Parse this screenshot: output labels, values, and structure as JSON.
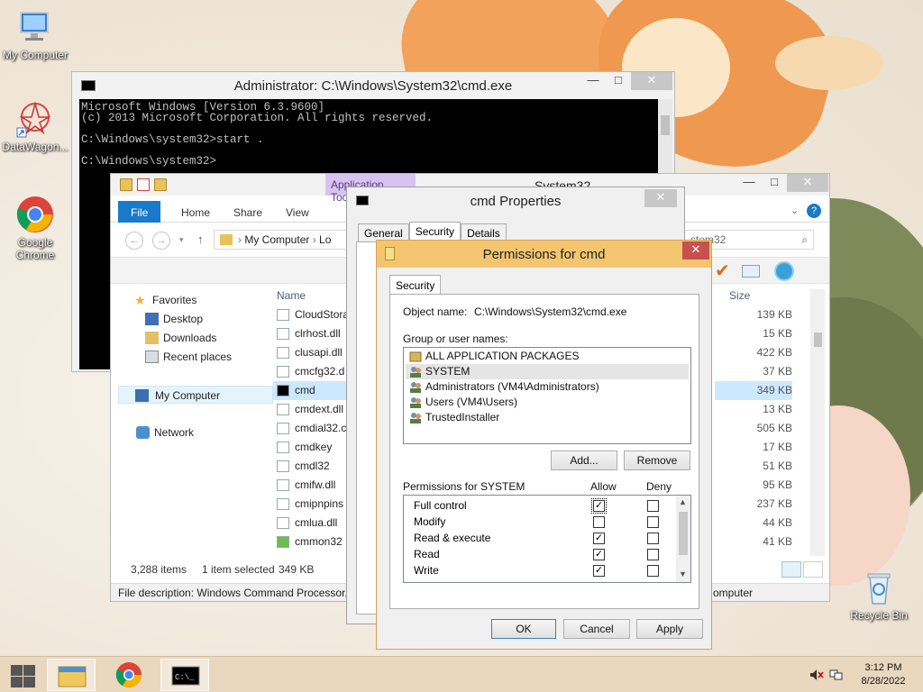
{
  "desktop": {
    "icons": [
      {
        "label": "My Computer",
        "icon": "computer-icon"
      },
      {
        "label": "DataWagon...",
        "icon": "datawagon-icon"
      },
      {
        "label": "Google Chrome",
        "icon": "chrome-icon"
      },
      {
        "label": "Recycle Bin",
        "icon": "recycle-bin-icon"
      }
    ]
  },
  "cmd": {
    "title": "Administrator: C:\\Windows\\System32\\cmd.exe",
    "lines": [
      "Microsoft Windows [Version 6.3.9600]",
      "(c) 2013 Microsoft Corporation. All rights reserved.",
      "",
      "C:\\Windows\\system32>start .",
      "",
      "C:\\Windows\\system32>"
    ],
    "controls": {
      "minimize": "—",
      "maximize": "□",
      "close": "✕"
    }
  },
  "explorer": {
    "context_tab": "Application Tools",
    "title": "System32",
    "ribbon_tabs": [
      "File",
      "Home",
      "Share",
      "View"
    ],
    "address": {
      "root": "My Computer",
      "next": "Lo"
    },
    "search_placeholder": "stem32",
    "nav": {
      "favorites": "Favorites",
      "desktop": "Desktop",
      "downloads": "Downloads",
      "recent": "Recent places",
      "my_computer": "My Computer",
      "network": "Network"
    },
    "columns": {
      "name": "Name",
      "size": "Size"
    },
    "files": [
      {
        "name": "CloudStora",
        "size": "139 KB"
      },
      {
        "name": "clrhost.dll",
        "size": "15 KB"
      },
      {
        "name": "clusapi.dll",
        "size": "422 KB"
      },
      {
        "name": "cmcfg32.d",
        "size": "37 KB"
      },
      {
        "name": "cmd",
        "size": "349 KB"
      },
      {
        "name": "cmdext.dll",
        "size": "13 KB"
      },
      {
        "name": "cmdial32.c",
        "size": "505 KB"
      },
      {
        "name": "cmdkey",
        "size": "17 KB"
      },
      {
        "name": "cmdl32",
        "size": "51 KB"
      },
      {
        "name": "cmifw.dll",
        "size": "95 KB"
      },
      {
        "name": "cmipnpins",
        "size": "237 KB"
      },
      {
        "name": "cmlua.dll",
        "size": "44 KB"
      },
      {
        "name": "cmmon32",
        "size": "41 KB"
      }
    ],
    "status": {
      "items": "3,288 items",
      "selected": "1 item selected",
      "size": "349 KB"
    },
    "description": "File description: Windows Command Processor,",
    "description_tail": "omputer",
    "controls": {
      "minimize": "—",
      "maximize": "□",
      "close": "✕"
    }
  },
  "props": {
    "title": "cmd Properties",
    "tabs": [
      "General",
      "Security",
      "Details"
    ],
    "active_tab": "Security",
    "close": "✕"
  },
  "perm": {
    "title": "Permissions for cmd",
    "tab": "Security",
    "object_label": "Object name:",
    "object_value": "C:\\Windows\\System32\\cmd.exe",
    "group_label": "Group or user names:",
    "groups": [
      {
        "name": "ALL APPLICATION PACKAGES",
        "icon": "package-icon"
      },
      {
        "name": "SYSTEM",
        "icon": "users-icon"
      },
      {
        "name": "Administrators (VM4\\Administrators)",
        "icon": "users-icon"
      },
      {
        "name": "Users (VM4\\Users)",
        "icon": "users-icon"
      },
      {
        "name": "TrustedInstaller",
        "icon": "users-icon"
      }
    ],
    "selected_group": "SYSTEM",
    "add_label": "Add...",
    "remove_label": "Remove",
    "permissions_label": "Permissions for SYSTEM",
    "allow_label": "Allow",
    "deny_label": "Deny",
    "permissions": [
      {
        "name": "Full control",
        "allow": true,
        "deny": false
      },
      {
        "name": "Modify",
        "allow": false,
        "deny": false
      },
      {
        "name": "Read & execute",
        "allow": true,
        "deny": false
      },
      {
        "name": "Read",
        "allow": true,
        "deny": false
      },
      {
        "name": "Write",
        "allow": true,
        "deny": false
      }
    ],
    "ok_label": "OK",
    "cancel_label": "Cancel",
    "apply_label": "Apply",
    "close": "✕",
    "accent": "#f4c56f"
  },
  "taskbar": {
    "time": "3:12 PM",
    "date": "8/28/2022",
    "items": [
      "file-explorer-icon",
      "chrome-icon",
      "cmd-icon"
    ]
  }
}
